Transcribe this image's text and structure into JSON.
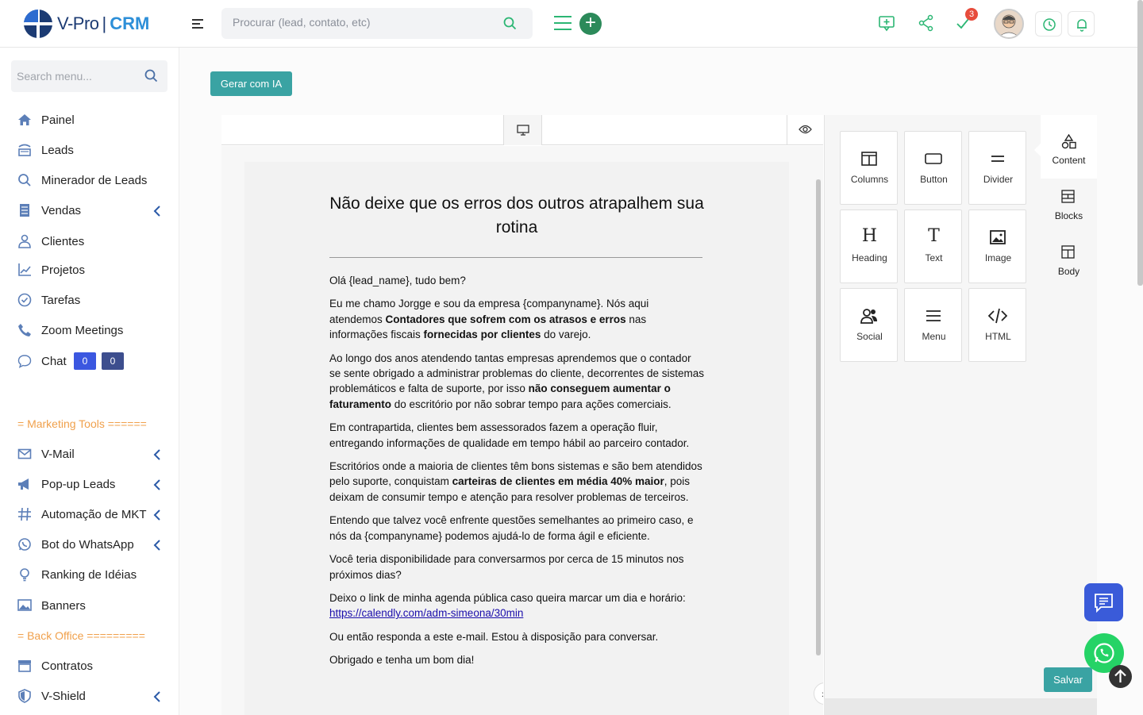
{
  "brand": {
    "name": "V-Pro",
    "separator": "|",
    "product": "CRM"
  },
  "topbar": {
    "search_placeholder": "Procurar (lead, contato, etc)",
    "notification_count": "3"
  },
  "sidebar": {
    "search_placeholder": "Search menu...",
    "items": [
      {
        "label": "Painel",
        "icon": "home-icon"
      },
      {
        "label": "Leads",
        "icon": "leads-icon"
      },
      {
        "label": "Minerador de Leads",
        "icon": "search-icon"
      },
      {
        "label": "Vendas",
        "icon": "sales-icon"
      },
      {
        "label": "Clientes",
        "icon": "user-icon"
      },
      {
        "label": "Projetos",
        "icon": "chart-icon"
      },
      {
        "label": "Tarefas",
        "icon": "check-circle-icon"
      },
      {
        "label": "Zoom Meetings",
        "icon": "phone-icon"
      },
      {
        "label": "Chat",
        "icon": "chat-icon"
      }
    ],
    "chat_badges": [
      "0",
      "0"
    ],
    "marketing_label": "= Marketing Tools ======",
    "marketing_items": [
      {
        "label": "V-Mail",
        "icon": "mail-icon"
      },
      {
        "label": "Pop-up Leads",
        "icon": "megaphone-icon"
      },
      {
        "label": "Automação de MKT",
        "icon": "hash-icon"
      },
      {
        "label": "Bot do WhatsApp",
        "icon": "whatsapp-icon"
      },
      {
        "label": "Ranking de Idéias",
        "icon": "lightbulb-icon"
      },
      {
        "label": "Banners",
        "icon": "image-icon"
      }
    ],
    "backoffice_label": "= Back Office =========",
    "backoffice_items": [
      {
        "label": "Contratos",
        "icon": "contract-icon"
      },
      {
        "label": "V-Shield",
        "icon": "shield-icon"
      }
    ]
  },
  "main": {
    "generate_label": "Gerar com IA",
    "save_label": "Salvar"
  },
  "email": {
    "title": "Não deixe que os erros dos outros atrapalhem sua rotina",
    "greeting": "Olá {lead_name}, tudo bem?",
    "p1_a": "Eu me chamo Jorgge e sou da empresa {companyname}. Nós aqui atendemos ",
    "p1_b": "Contadores que sofrem com os atrasos e erros",
    "p1_c": " nas informações fiscais ",
    "p1_d": "fornecidas por clientes",
    "p1_e": " do varejo.",
    "p2_a": "Ao longo dos anos atendendo tantas empresas aprendemos que o contador se sente obrigado a administrar problemas do cliente, decorrentes de sistemas problemáticos e falta de suporte, por isso ",
    "p2_b": "não conseguem aumentar o faturamento",
    "p2_c": " do escritório por não sobrar tempo para ações comerciais.",
    "p3": "Em contrapartida, clientes bem assessorados fazem a operação fluir, entregando informações de qualidade em tempo hábil ao parceiro contador.",
    "p4_a": "Escritórios onde a maioria de clientes têm bons sistemas e são bem atendidos pelo suporte, conquistam ",
    "p4_b": "carteiras de clientes em média 40% maior",
    "p4_c": ", pois deixam de consumir tempo e atenção para resolver problemas de terceiros.",
    "p5": "Entendo que talvez você enfrente questões semelhantes ao primeiro caso, e nós da {companyname} podemos ajudá-lo de forma ágil e eficiente.",
    "p6": "Você teria disponibilidade para conversarmos por cerca de 15 minutos nos próximos dias?",
    "p7": "Deixo o link de minha agenda pública caso queira marcar um dia e horário:",
    "link": "https://calendly.com/adm-simeona/30min",
    "p8": "Ou então responda a este e-mail. Estou à disposição para conversar.",
    "p9": "Obrigado e tenha um bom dia!"
  },
  "tools": [
    {
      "label": "Columns",
      "icon": "columns-icon"
    },
    {
      "label": "Button",
      "icon": "button-icon"
    },
    {
      "label": "Divider",
      "icon": "divider-icon"
    },
    {
      "label": "Heading",
      "glyph": "H",
      "icon": "heading-icon"
    },
    {
      "label": "Text",
      "glyph": "T",
      "icon": "text-icon"
    },
    {
      "label": "Image",
      "icon": "image-icon"
    },
    {
      "label": "Social",
      "icon": "social-icon"
    },
    {
      "label": "Menu",
      "icon": "menu-icon"
    },
    {
      "label": "HTML",
      "icon": "html-icon"
    }
  ],
  "tabs": [
    {
      "label": "Content",
      "icon": "shapes-icon"
    },
    {
      "label": "Blocks",
      "icon": "blocks-icon"
    },
    {
      "label": "Body",
      "icon": "body-icon"
    }
  ],
  "colors": {
    "accent_teal": "#3aa3a3",
    "brand_blue": "#1c3b73",
    "green": "#2bb673",
    "section_orange": "#f0a04b",
    "chat_blue": "#3a5bd9"
  }
}
